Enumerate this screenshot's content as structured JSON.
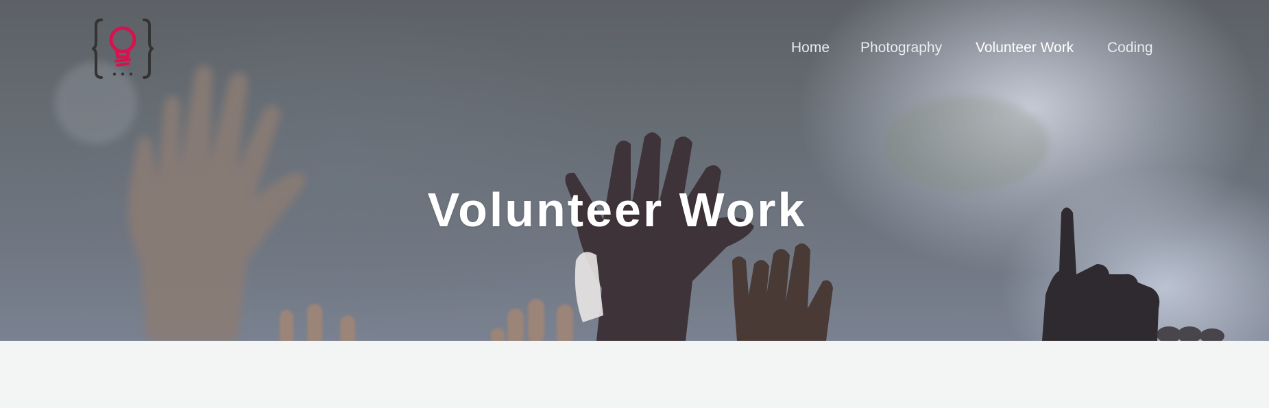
{
  "logo": {
    "icon": "lightbulb-braces-logo",
    "accent_color": "#d6124f",
    "brace_color": "#333333"
  },
  "nav": {
    "items": [
      {
        "label": "Home",
        "active": false
      },
      {
        "label": "Photography",
        "active": false
      },
      {
        "label": "Volunteer Work",
        "active": true
      },
      {
        "label": "Coding",
        "active": false
      }
    ]
  },
  "hero": {
    "title": "Volunteer Work",
    "background_description_icon": "raised-hands-photo"
  },
  "colors": {
    "nav_text": "#e9ebee",
    "title_text": "#ffffff",
    "page_background": "#f3f5f4"
  }
}
